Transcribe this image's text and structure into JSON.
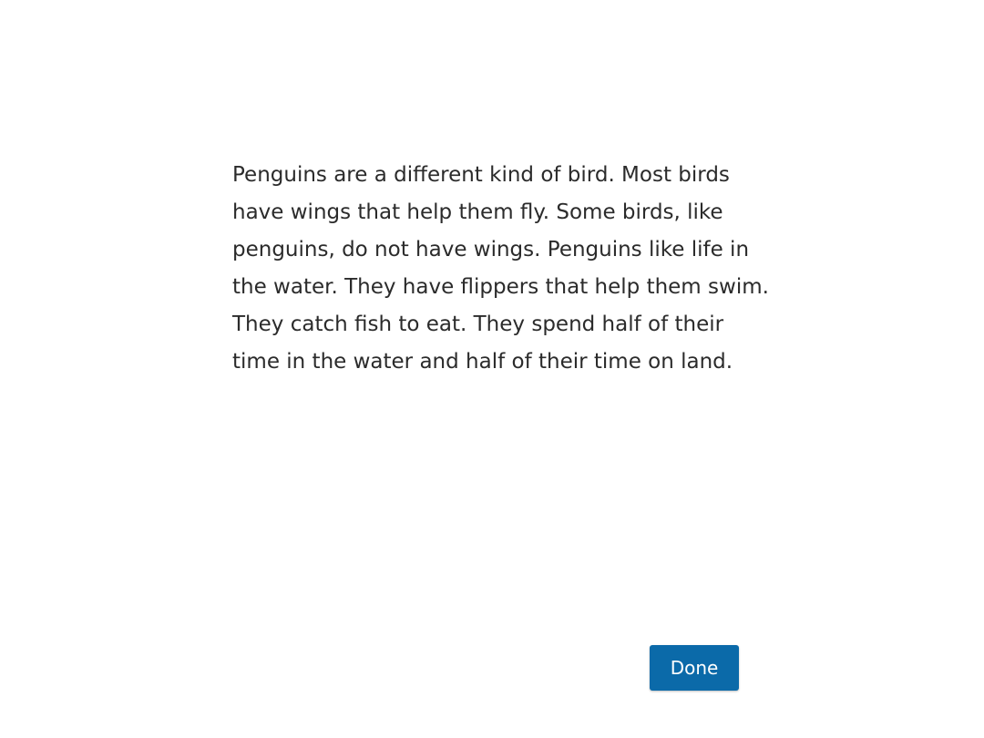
{
  "passage": {
    "text": "Penguins are a different kind of bird. Most birds have wings that help them fly. Some birds, like penguins, do not have wings. Penguins like life in the water. They have flippers that help them swim. They catch fish to eat. They spend half of their time in the water and half of their time on land."
  },
  "actions": {
    "done_label": "Done"
  },
  "colors": {
    "background": "#ffffff",
    "text": "#2b2b2b",
    "button_background": "#0b6aa9",
    "button_text": "#ffffff"
  }
}
